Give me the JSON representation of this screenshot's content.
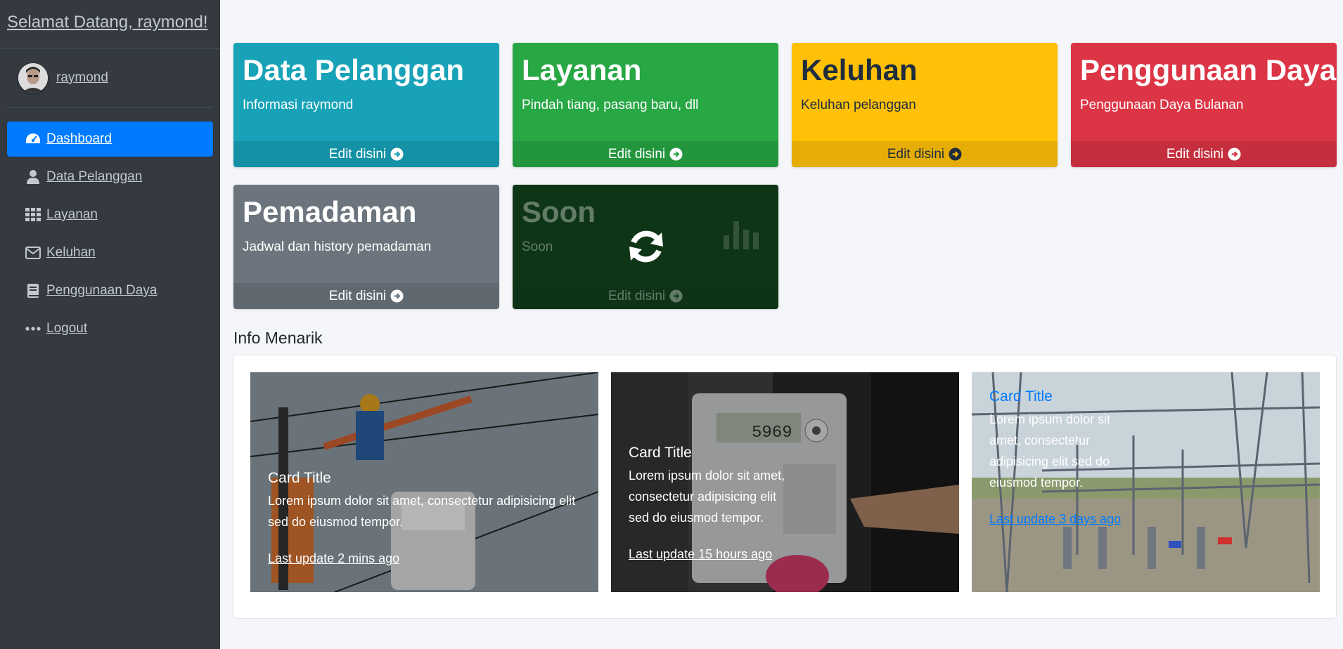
{
  "sidebar": {
    "brand": "Selamat Datang, raymond!",
    "user_name": "raymond",
    "items": [
      {
        "label": " Dashboard",
        "icon": "tachometer-icon",
        "active": true
      },
      {
        "label": " Data Pelanggan",
        "icon": "user-icon",
        "active": false
      },
      {
        "label": " Layanan",
        "icon": "grid-icon",
        "active": false
      },
      {
        "label": " Keluhan",
        "icon": "envelope-icon",
        "active": false
      },
      {
        "label": " Penggunaan Daya",
        "icon": "book-icon",
        "active": false
      },
      {
        "label": " Logout",
        "icon": "ellipsis-icon",
        "active": false
      }
    ]
  },
  "boxes": [
    {
      "title": "Data Pelanggan",
      "subtitle": "Informasi raymond",
      "link": "Edit disini",
      "color": "#17a2b8"
    },
    {
      "title": "Layanan",
      "subtitle": "Pindah tiang, pasang baru, dll",
      "link": "Edit disini",
      "color": "#28a745"
    },
    {
      "title": "Keluhan",
      "subtitle": "Keluhan pelanggan",
      "link": "Edit disini",
      "color": "#ffc107"
    },
    {
      "title": "Penggunaan Daya",
      "subtitle": "Penggunaan Daya Bulanan",
      "link": "Edit disini",
      "color": "#dc3545"
    },
    {
      "title": "Pemadaman",
      "subtitle": "Jadwal dan history pemadaman",
      "link": "Edit disini",
      "color": "#6c757d"
    },
    {
      "title": "Soon",
      "subtitle": "Soon",
      "link": "Edit disini",
      "color": "#28a745"
    }
  ],
  "info": {
    "section_title": "Info Menarik",
    "cards": [
      {
        "title": "Card Title",
        "text": "Lorem ipsum dolor sit amet, consectetur adipisicing elit sed do eiusmod tempor.",
        "updated": "Last update 2 mins ago"
      },
      {
        "title": "Card Title",
        "text": "Lorem ipsum dolor sit amet, consectetur adipisicing elit sed do eiusmod tempor.",
        "updated": "Last update 15 hours ago"
      },
      {
        "title": "Card Title",
        "text": "Lorem ipsum dolor sit amet, consectetur adipisicing elit sed do eiusmod tempor.",
        "updated": "Last update 3 days ago"
      }
    ]
  }
}
